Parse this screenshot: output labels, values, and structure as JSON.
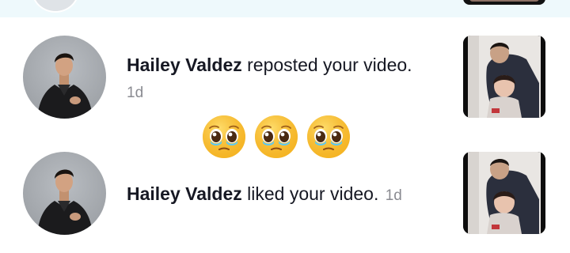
{
  "notifications": [
    {
      "username": "Hailey Valdez",
      "action": " reposted your video.",
      "time": "1d",
      "avatar_icon": "user-avatar-photo",
      "thumbnail_icon": "video-thumbnail"
    },
    {
      "username": "Hailey Valdez",
      "action": " liked your video.",
      "time": "1d",
      "avatar_icon": "user-avatar-photo",
      "thumbnail_icon": "video-thumbnail"
    }
  ],
  "comment_emojis": [
    "🥹",
    "🥹",
    "🥹"
  ],
  "colors": {
    "highlight_strip": "#eef9fc",
    "text_primary": "#161823",
    "text_secondary": "#8a8b91",
    "emoji_face": "#f8c12b"
  }
}
